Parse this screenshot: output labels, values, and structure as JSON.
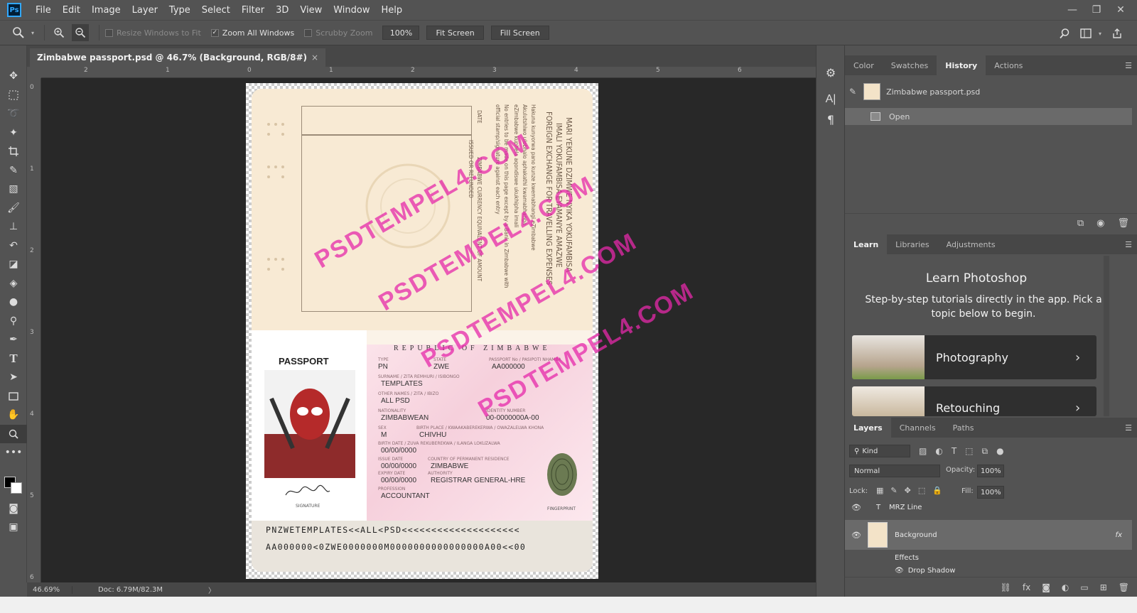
{
  "app": {
    "logo": "Ps"
  },
  "menu": [
    "File",
    "Edit",
    "Image",
    "Layer",
    "Type",
    "Select",
    "Filter",
    "3D",
    "View",
    "Window",
    "Help"
  ],
  "window_controls": {
    "minimize": "—",
    "restore": "❐",
    "close": "✕"
  },
  "options": {
    "resize_windows": "Resize Windows to Fit",
    "zoom_all": "Zoom All Windows",
    "scrubby": "Scrubby Zoom",
    "zoom_value": "100%",
    "fit_screen": "Fit Screen",
    "fill_screen": "Fill Screen"
  },
  "document": {
    "tab_title": "Zimbabwe passport.psd @ 46.7% (Background, RGB/8#)",
    "close": "×"
  },
  "ruler": {
    "top": [
      "2",
      "1",
      "0",
      "1",
      "2",
      "3",
      "4",
      "5",
      "6"
    ],
    "left": [
      "0",
      "1",
      "2",
      "3",
      "4",
      "5",
      "6"
    ]
  },
  "passport": {
    "top_lines": [
      "MARI YEKUNE DZIMWE NYIKA YOKUFAMBISA",
      "IMALI YOKUFAMBISA EYAMANYE AMAZWE",
      "FOREIGN EXCHANGE FOR TRAVELLING EXPENSES",
      "Hakuna kunyorwa pano kunze kwemabhangi eZimbabwe",
      "Akulutshiwo ulobhalo aphakathi kwamabhanga",
      "eZimbabwe kuphela aqondiswe ukukhipha imali",
      "No entries to be made on this page except by a Bank in Zimbabwe with",
      "official stamp/signature against each entry"
    ],
    "date_label": "DATE",
    "amount_label": "ZIMBABWE CURRENCY EQUIVALENT OF AMOUNT",
    "issued_label": "ISSUED OR REFUNDED",
    "header": "REPUBLIC OF ZIMBABWE",
    "title": "PASSPORT",
    "signature_label": "SIGNATURE",
    "fingerprint_label": "FINGERPRINT",
    "fields": {
      "type_label": "TYPE",
      "type": "PN",
      "state_label": "STATE",
      "state": "ZWE",
      "passport_no_label": "PASSPORT No / PASIPOTI NHAMBA",
      "passport_no": "AA000000",
      "surname_label": "SURNAME / ZITA REMHURI / ISIBONGO",
      "surname": "TEMPLATES",
      "other_names_label": "OTHER NAMES / ZITA / IBIZO",
      "other_names": "ALL PSD",
      "nationality_label": "NATIONALITY",
      "nationality": "ZIMBABWEAN",
      "id_label": "IDENTITY NUMBER",
      "id": "00-0000000A-00",
      "sex_label": "SEX",
      "sex": "M",
      "birthplace_label": "BIRTH PLACE / KWAAKABEREKERWA / OWAZALELWA KHONA",
      "birthplace": "CHIVHU",
      "birthdate_label": "BIRTH DATE / ZUVA REKUBEREKWA / ILANGA LOKUZALWA",
      "birthdate": "00/00/0000",
      "issue_label": "ISSUE DATE",
      "issue": "00/00/0000",
      "residence_label": "COUNTRY OF PERMANENT RESIDENCE",
      "residence": "ZIMBABWE",
      "expiry_label": "EXPIRY DATE",
      "expiry": "00/00/0000",
      "authority_label": "AUTHORITY",
      "authority": "REGISTRAR GENERAL-HRE",
      "profession_label": "PROFESSION",
      "profession": "ACCOUNTANT"
    },
    "mrz1": "PNZWETEMPLATES<<ALL<PSD<<<<<<<<<<<<<<<<<<<<",
    "mrz2": "AA000000<0ZWE0000000M0000000000000000A00<<00",
    "watermark": "PSDTEMPEL4.COM"
  },
  "status": {
    "zoom": "46.69%",
    "doc": "Doc: 6.79M/82.3M",
    "arrow": "〉"
  },
  "panels": {
    "top_tabs": [
      "Color",
      "Swatches",
      "History",
      "Actions"
    ],
    "history_snapshot": "Zimbabwe passport.psd",
    "history_item": "Open",
    "mid_tabs": [
      "Learn",
      "Libraries",
      "Adjustments"
    ],
    "learn_title": "Learn Photoshop",
    "learn_desc": "Step-by-step tutorials directly in the app. Pick a topic below to begin.",
    "learn_cards": [
      "Photography",
      "Retouching"
    ],
    "layer_tabs": [
      "Layers",
      "Channels",
      "Paths"
    ],
    "kind": "Kind",
    "blend_mode": "Normal",
    "opacity_label": "Opacity:",
    "opacity": "100%",
    "lock_label": "Lock:",
    "fill_label": "Fill:",
    "fill": "100%",
    "layers": [
      "MRZ Line",
      "Background"
    ],
    "effects": "Effects",
    "drop_shadow": "Drop Shadow",
    "fx": "fx"
  },
  "colors": {
    "accent": "#31a8ff",
    "watermark": "#e628aa"
  }
}
